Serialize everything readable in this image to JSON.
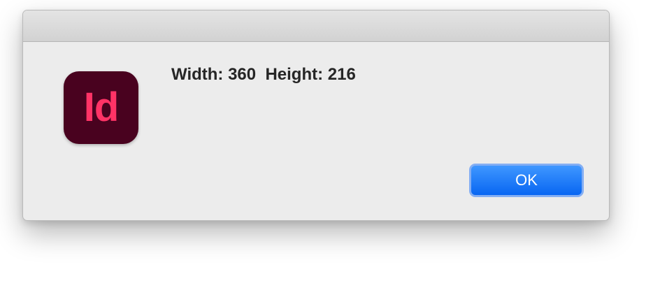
{
  "dialog": {
    "app_icon": {
      "name": "indesign-app-icon",
      "text": "Id",
      "background_color": "#49021f",
      "text_color": "#ff3366"
    },
    "message": "Width: 360  Height: 216",
    "ok_label": "OK",
    "accent_color": "#1a7cff"
  }
}
